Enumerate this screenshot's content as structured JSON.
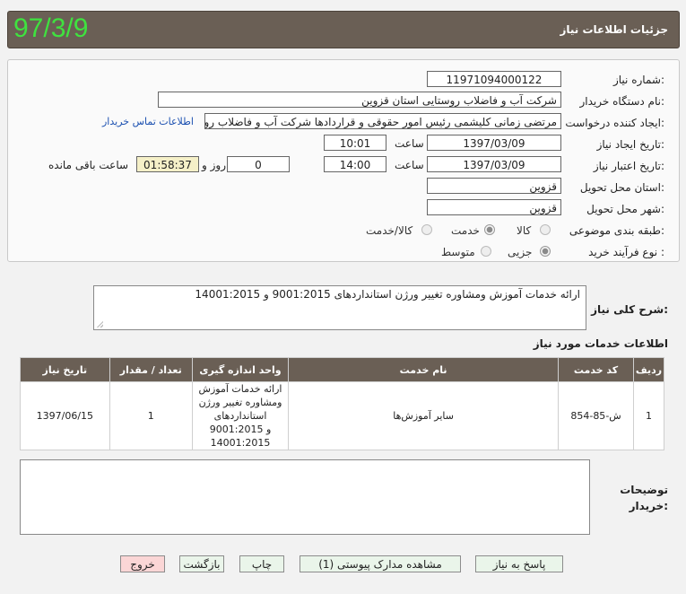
{
  "header": {
    "title": "جزئیات اطلاعات نیاز",
    "date": "97/3/9"
  },
  "form": {
    "need_number_label": "شماره نیاز:",
    "need_number": "11971094000122",
    "buyer_label": "نام دستگاه خریدار:",
    "buyer": "شرکت آب و فاضلاب روستایی استان قزوین",
    "requester_label": "ایجاد کننده درخواست:",
    "requester": "مرتضی زمانی کلیشمی رئیس امور حقوقی و قراردادها شرکت آب و فاضلاب روس",
    "contact_link": "اطلاعات تماس خریدار",
    "created_label": "تاریخ ایجاد نیاز:",
    "created_date": "1397/03/09",
    "time_label": "ساعت",
    "created_time": "10:01",
    "validity_label": "تاریخ اعتبار نیاز:",
    "validity_date": "1397/03/09",
    "validity_time": "14:00",
    "days": "0",
    "day_and_label": "روز و",
    "remaining": "01:58:37",
    "remaining_label": "ساعت باقی مانده",
    "province_label": "استان محل تحویل:",
    "province": "قزوین",
    "city_label": "شهر محل تحویل:",
    "city": "قزوین",
    "category_label": "طبقه بندی موضوعی:",
    "category_options": [
      "کالا",
      "خدمت",
      "کالا/خدمت"
    ],
    "category_selected": "خدمت",
    "process_label": "نوع فرآیند خرید :",
    "process_options": [
      "جزیی",
      "متوسط"
    ],
    "process_selected": "جزیی"
  },
  "summary": {
    "label": "شرح کلی نیاز:",
    "text": "ارائه خدمات آموزش ومشاوره تغییر ورژن استانداردهای 9001:2015 و  14001:2015"
  },
  "services": {
    "title": "اطلاعات خدمات مورد نیاز",
    "columns": [
      "ردیف",
      "کد خدمت",
      "نام خدمت",
      "واحد اندازه گیری",
      "تعداد / مقدار",
      "تاریخ نیاز"
    ],
    "rows": [
      {
        "index": "1",
        "code": "ش-85-854",
        "name": "سایر آموزش‌ها",
        "unit_lines": [
          "ارائه خدمات آموزش",
          "ومشاوره تغییر ورژن",
          "استانداردهای",
          "9001:2015 و",
          "14001:2015"
        ],
        "quantity": "1",
        "date": "1397/06/15"
      }
    ]
  },
  "notes": {
    "label": "توضیحات خریدار:",
    "text": ""
  },
  "buttons": {
    "reply": "پاسخ به نیاز",
    "attachments": "مشاهده مدارک پیوستی (1)",
    "print": "چاپ",
    "back": "بازگشت",
    "exit": "خروج"
  },
  "colors": {
    "header_bg": "#6a5f55",
    "date_green": "#3fe23f",
    "exit_button": "#fbd6d6",
    "button_bg": "#eaf5ea"
  }
}
